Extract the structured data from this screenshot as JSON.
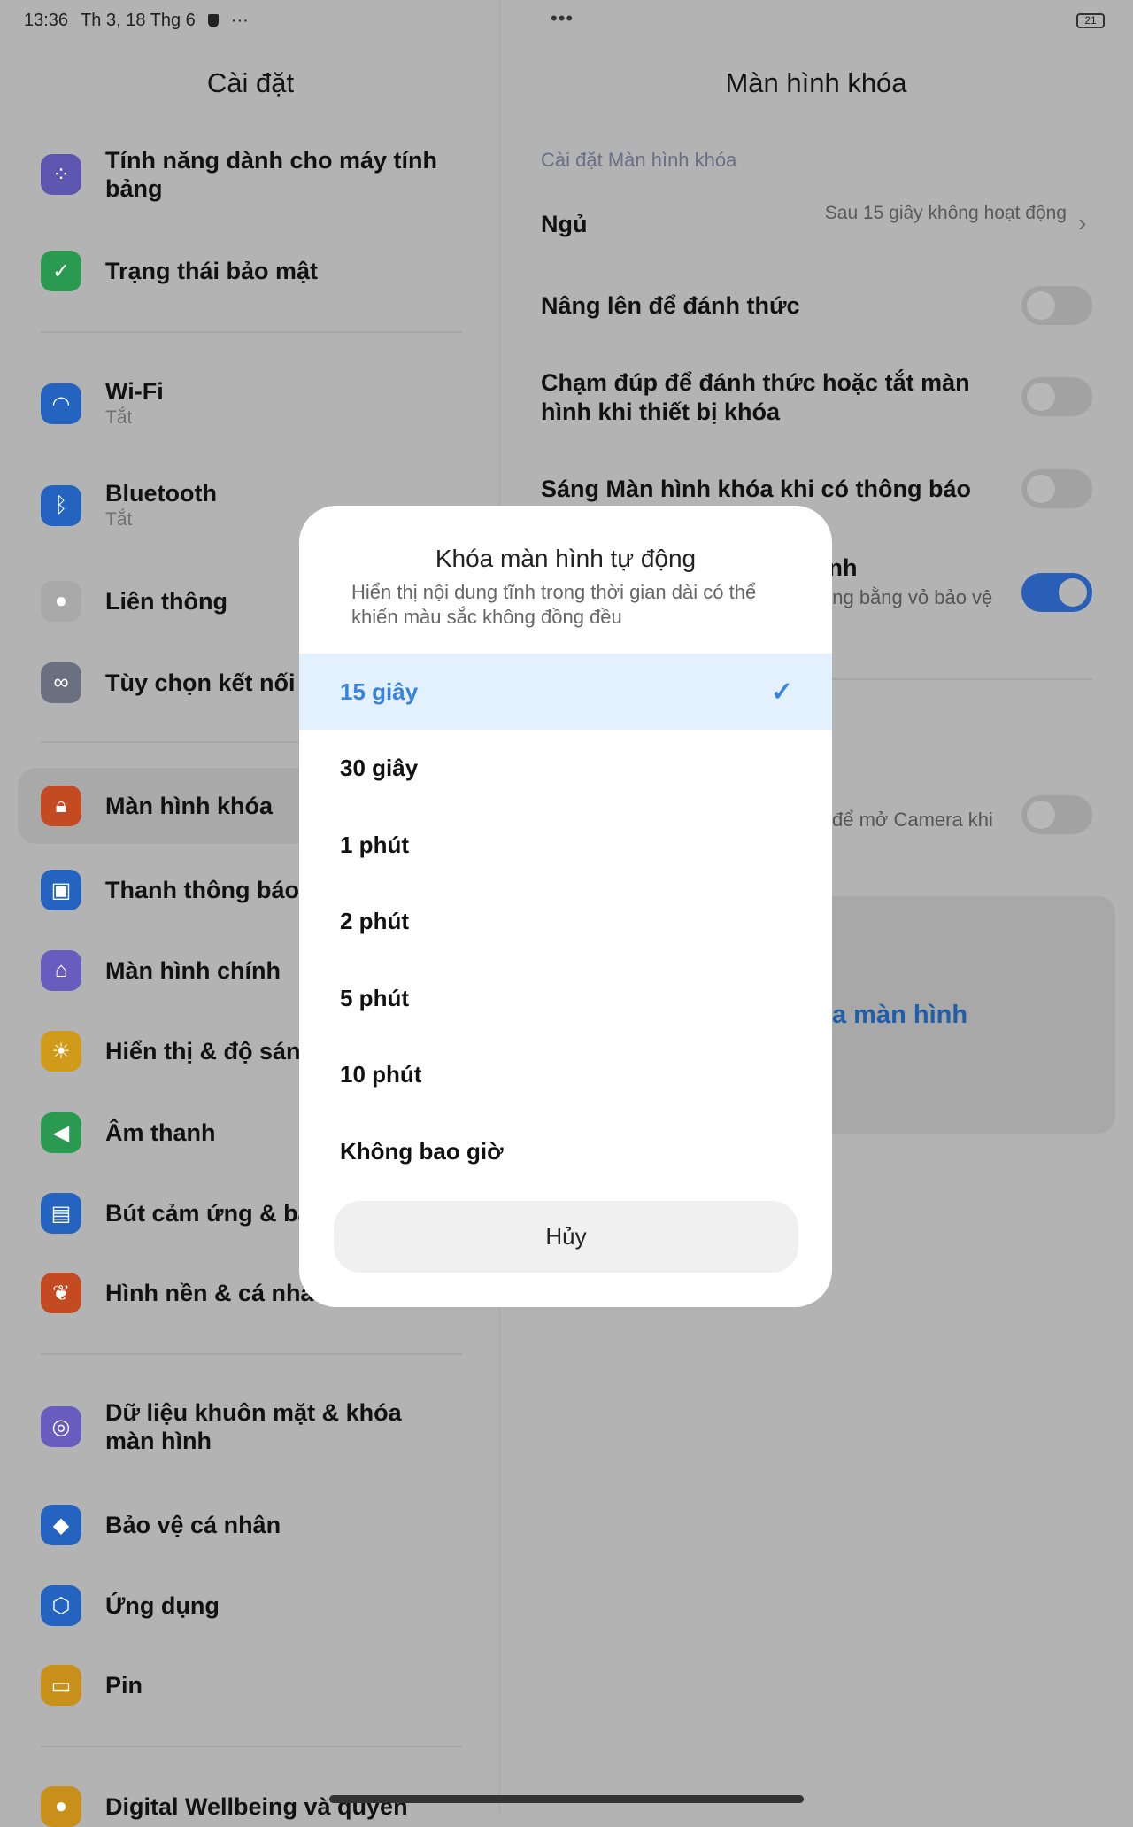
{
  "status_bar": {
    "time": "13:36",
    "date": "Th 3, 18 Thg 6",
    "more": "···",
    "center_dots": "•••",
    "battery": "21"
  },
  "left": {
    "title": "Cài đặt",
    "items": [
      {
        "label": "Tính năng dành cho máy tính bảng",
        "icon": "tablet-features-icon",
        "color": "#5d56b0"
      },
      {
        "label": "Trạng thái bảo mật",
        "icon": "shield-icon",
        "color": "#2a9a50"
      },
      {
        "label": "Wi-Fi",
        "sub": "Tắt",
        "icon": "wifi-icon",
        "color": "#2563c0"
      },
      {
        "label": "Bluetooth",
        "sub": "Tắt",
        "icon": "bluetooth-icon",
        "color": "#2563c0"
      },
      {
        "label": "Liên thông",
        "icon": "interconnect-icon",
        "color": "#a9a9a9"
      },
      {
        "label": "Tùy chọn kết nối k",
        "icon": "link-icon",
        "color": "#6b7080"
      },
      {
        "label": "Màn hình khóa",
        "icon": "lock-icon",
        "color": "#c44a22"
      },
      {
        "label": "Thanh thông báo",
        "icon": "notification-icon",
        "color": "#2563c0"
      },
      {
        "label": "Màn hình chính",
        "icon": "home-icon",
        "color": "#6a5cbf"
      },
      {
        "label": "Hiển thị & độ sáng",
        "icon": "brightness-icon",
        "color": "#d09a1a"
      },
      {
        "label": "Âm thanh",
        "icon": "speaker-icon",
        "color": "#2a9a50"
      },
      {
        "label": "Bút cảm ứng & bà",
        "icon": "keyboard-icon",
        "color": "#2563c0"
      },
      {
        "label": "Hình nền & cá nhân",
        "icon": "wallpaper-icon",
        "color": "#c44a22"
      },
      {
        "label": "Dữ liệu khuôn mặt & khóa màn hình",
        "icon": "face-icon",
        "color": "#6a5cbf"
      },
      {
        "label": "Bảo vệ cá nhân",
        "icon": "privacy-icon",
        "color": "#2563c0"
      },
      {
        "label": "Ứng dụng",
        "icon": "apps-icon",
        "color": "#2563c0"
      },
      {
        "label": "Pin",
        "icon": "battery-icon",
        "color": "#c8901a"
      },
      {
        "label": "Digital Wellbeing và quyền",
        "icon": "wellbeing-icon",
        "color": "#c8901a"
      }
    ]
  },
  "right": {
    "title": "Màn hình khóa",
    "section": "Cài đặt Màn hình khóa",
    "sleep_label": "Ngủ",
    "sleep_value": "Sau 15 giây không hoạt động",
    "raise_label": "Nâng lên để đánh thức",
    "raise_on": false,
    "double_tap_label": "Chạm đúp để đánh thức hoặc tắt màn hình khi thiết bị khóa",
    "double_tap_on": false,
    "notif_label": "Sáng Màn hình khóa khi có thông báo",
    "notif_on": false,
    "cover_label_fragment": "inh",
    "cover_sub_fragment": "ộng bằng vỏ bảo vệ",
    "cover_on": true,
    "camera_fragment": "để mở Camera khi",
    "camera_on": false,
    "card_link_fragment": "a màn hình"
  },
  "dialog": {
    "title": "Khóa màn hình tự động",
    "subtitle": "Hiển thị nội dung tĩnh trong thời gian dài có thể khiến màu sắc không đồng đều",
    "options": [
      "15 giây",
      "30 giây",
      "1 phút",
      "2 phút",
      "5 phút",
      "10 phút",
      "Không bao giờ"
    ],
    "selected": "15 giây",
    "cancel": "Hủy",
    "accent": "#3a82e0"
  }
}
